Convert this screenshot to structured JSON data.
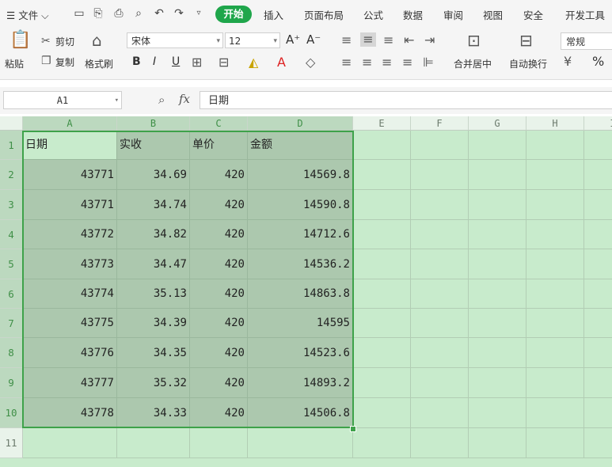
{
  "menu": {
    "file": "文件",
    "tabs": [
      "开始",
      "插入",
      "页面布局",
      "公式",
      "数据",
      "审阅",
      "视图",
      "安全",
      "开发工具"
    ],
    "active_tab": "开始"
  },
  "ribbon": {
    "paste": "粘贴",
    "cut": "剪切",
    "copy": "复制",
    "format_painter": "格式刷",
    "font_name": "宋体",
    "font_size": "12",
    "bold": "B",
    "italic": "I",
    "underline": "U",
    "merge_center": "合并居中",
    "wrap_text": "自动换行",
    "number_format": "常规",
    "percent": "%",
    "grow_font": "A⁺",
    "shrink_font": "A⁻"
  },
  "formula_bar": {
    "name_box": "A1",
    "fx": "fx",
    "content": "日期"
  },
  "sheet": {
    "columns": [
      "A",
      "B",
      "C",
      "D",
      "E",
      "F",
      "G",
      "H",
      "I"
    ],
    "rows": [
      "1",
      "2",
      "3",
      "4",
      "5",
      "6",
      "7",
      "8",
      "9",
      "10",
      "11"
    ],
    "header": [
      "日期",
      "实收",
      "单价",
      "金额"
    ],
    "data": [
      [
        "43771",
        "34.69",
        "420",
        "14569.8"
      ],
      [
        "43771",
        "34.74",
        "420",
        "14590.8"
      ],
      [
        "43772",
        "34.82",
        "420",
        "14712.6"
      ],
      [
        "43773",
        "34.47",
        "420",
        "14536.2"
      ],
      [
        "43774",
        "35.13",
        "420",
        "14863.8"
      ],
      [
        "43775",
        "34.39",
        "420",
        "14595"
      ],
      [
        "43776",
        "34.35",
        "420",
        "14523.6"
      ],
      [
        "43777",
        "35.32",
        "420",
        "14893.2"
      ],
      [
        "43778",
        "34.33",
        "420",
        "14506.8"
      ]
    ]
  },
  "colors": {
    "accent": "#1fa64b",
    "sheet_bg": "#c8ebcc",
    "selection": "#acc8ae",
    "selection_border": "#3ea24a"
  }
}
